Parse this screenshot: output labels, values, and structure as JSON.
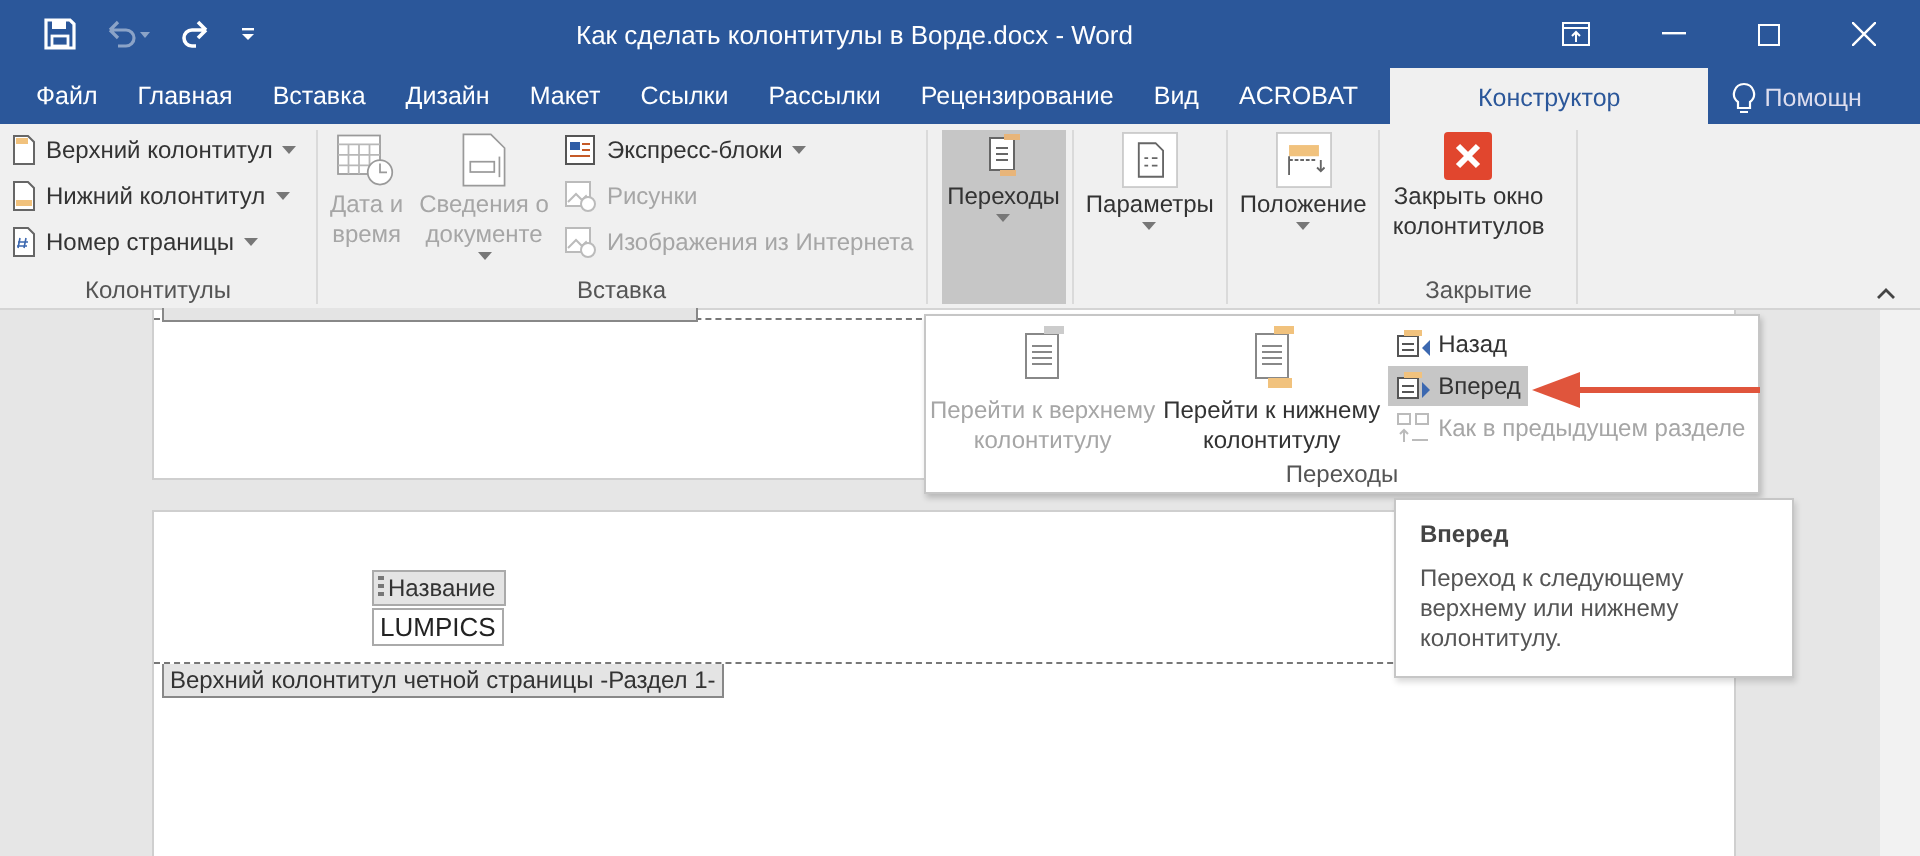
{
  "window": {
    "title": "Как сделать колонтитулы в Ворде.docx - Word"
  },
  "quick_access": [
    {
      "kind": "save",
      "disabled": false
    },
    {
      "kind": "undo",
      "disabled": true
    },
    {
      "kind": "redo",
      "disabled": false
    },
    {
      "kind": "customize",
      "disabled": false
    }
  ],
  "tabs": [
    {
      "label": "Файл",
      "selected": false
    },
    {
      "label": "Главная",
      "selected": false
    },
    {
      "label": "Вставка",
      "selected": false
    },
    {
      "label": "Дизайн",
      "selected": false
    },
    {
      "label": "Макет",
      "selected": false
    },
    {
      "label": "Ссылки",
      "selected": false
    },
    {
      "label": "Рассылки",
      "selected": false
    },
    {
      "label": "Рецензирование",
      "selected": false
    },
    {
      "label": "Вид",
      "selected": false
    },
    {
      "label": "ACROBAT",
      "selected": false
    },
    {
      "label": "Конструктор",
      "selected": true
    }
  ],
  "help": {
    "label": "Помощн"
  },
  "ribbon": {
    "groups": [
      {
        "title": "Колонтитулы",
        "small": [
          {
            "kind": "header",
            "label": "Верхний колонтитул",
            "dropdown": true,
            "disabled": false
          },
          {
            "kind": "footer",
            "label": "Нижний колонтитул",
            "dropdown": true,
            "disabled": false
          },
          {
            "kind": "page-number",
            "label": "Номер страницы",
            "dropdown": true,
            "disabled": false
          }
        ]
      },
      {
        "title": "Вставка",
        "large": [
          {
            "kind": "calendar",
            "lines": [
              "Дата и",
              "время"
            ],
            "dropdown": false,
            "disabled": true,
            "selected": false
          },
          {
            "kind": "document",
            "lines": [
              "Сведения о",
              "документе"
            ],
            "dropdown": true,
            "disabled": true,
            "selected": false
          }
        ],
        "small": [
          {
            "kind": "blocks",
            "label": "Экспресс-блоки",
            "dropdown": true,
            "disabled": false
          },
          {
            "kind": "pictures",
            "label": "Рисунки",
            "dropdown": false,
            "disabled": true
          },
          {
            "kind": "online-pictures",
            "label": "Изображения из Интернета",
            "dropdown": false,
            "disabled": true
          }
        ]
      },
      {
        "large": [
          {
            "kind": "navigation",
            "lines": [
              "Переходы"
            ],
            "dropdown": true,
            "disabled": false,
            "selected": true
          }
        ]
      },
      {
        "large": [
          {
            "kind": "options",
            "lines": [
              "Параметры"
            ],
            "dropdown": true,
            "disabled": false,
            "selected": false
          }
        ]
      },
      {
        "large": [
          {
            "kind": "position",
            "lines": [
              "Положение"
            ],
            "dropdown": true,
            "disabled": false,
            "selected": false
          }
        ]
      },
      {
        "title": "Закрытие",
        "large": [
          {
            "kind": "close",
            "lines": [
              "Закрыть окно",
              "колонтитулов"
            ],
            "dropdown": false,
            "disabled": false,
            "selected": false
          }
        ]
      }
    ]
  },
  "navigation_panel": {
    "title": "Переходы",
    "large": [
      {
        "kind": "go-header",
        "lines": [
          "Перейти к верхнему",
          "колонтитулу"
        ],
        "disabled": true
      },
      {
        "kind": "go-footer",
        "lines": [
          "Перейти к нижнему",
          "колонтитулу"
        ],
        "disabled": false
      }
    ],
    "small": [
      {
        "kind": "previous",
        "label": "Назад",
        "disabled": false,
        "selected": false
      },
      {
        "kind": "next",
        "label": "Вперед",
        "disabled": false,
        "selected": true
      },
      {
        "kind": "link",
        "label": "Как в предыдущем разделе",
        "disabled": true,
        "selected": false
      }
    ]
  },
  "tooltip": {
    "title": "Вперед",
    "text": "Переход к следующему верхнему или нижнему колонтитулу."
  },
  "document": {
    "content_control": {
      "title": "Название",
      "value": "LUMPICS"
    },
    "header_tag": "Верхний колонтитул четной страницы -Раздел 1-"
  }
}
